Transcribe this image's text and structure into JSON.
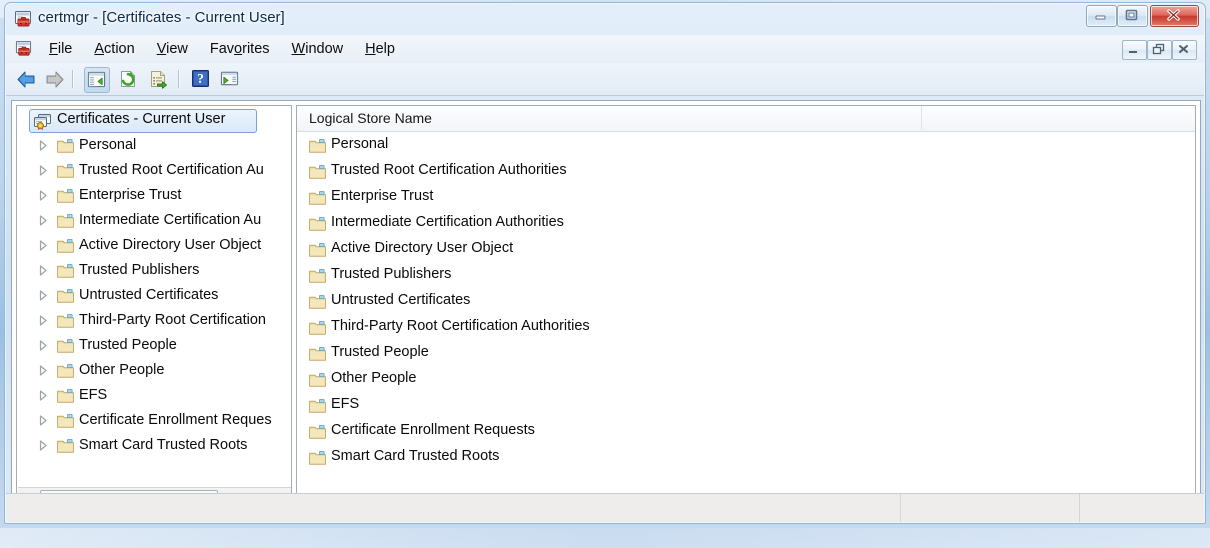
{
  "window": {
    "title": "certmgr - [Certificates - Current User]",
    "app_icon": "mmc-console-icon",
    "controls": {
      "minimize": "Minimize",
      "maximize": "Maximize",
      "close": "Close"
    }
  },
  "menu": {
    "icon": "mmc-console-icon",
    "items": [
      {
        "name": "file",
        "pre": "",
        "accel": "F",
        "post": "ile"
      },
      {
        "name": "action",
        "pre": "",
        "accel": "A",
        "post": "ction"
      },
      {
        "name": "view",
        "pre": "",
        "accel": "V",
        "post": "iew"
      },
      {
        "name": "favorites",
        "pre": "Fav",
        "accel": "o",
        "post": "rites"
      },
      {
        "name": "window",
        "pre": "",
        "accel": "W",
        "post": "indow"
      },
      {
        "name": "help",
        "pre": "",
        "accel": "H",
        "post": "elp"
      }
    ],
    "mdi_controls": {
      "minimize": "Minimize",
      "restore": "Restore",
      "close": "Close"
    }
  },
  "toolbar": {
    "buttons": [
      {
        "name": "back-button",
        "icon": "back-arrow-icon",
        "label": "Back"
      },
      {
        "name": "forward-button",
        "icon": "forward-arrow-icon",
        "label": "Forward"
      },
      {
        "name": "show-tree-button",
        "icon": "show-hide-tree-icon",
        "label": "Show/Hide Console Tree",
        "pressed": true
      },
      {
        "name": "refresh-button",
        "icon": "refresh-icon",
        "label": "Refresh"
      },
      {
        "name": "export-list-button",
        "icon": "export-list-icon",
        "label": "Export List"
      },
      {
        "name": "help-button",
        "icon": "help-icon",
        "label": "Help"
      },
      {
        "name": "show-action-pane-button",
        "icon": "action-pane-icon",
        "label": "Show/Hide Action Pane"
      }
    ]
  },
  "tree": {
    "root": {
      "label": "Certificates - Current User",
      "icon": "certificate-store-icon",
      "selected": true
    },
    "nodes": [
      {
        "label": "Personal",
        "icon": "folder-icon"
      },
      {
        "label": "Trusted Root Certification Au",
        "icon": "folder-icon"
      },
      {
        "label": "Enterprise Trust",
        "icon": "folder-icon"
      },
      {
        "label": "Intermediate Certification Au",
        "icon": "folder-icon"
      },
      {
        "label": "Active Directory User Object",
        "icon": "folder-icon"
      },
      {
        "label": "Trusted Publishers",
        "icon": "folder-icon"
      },
      {
        "label": "Untrusted Certificates",
        "icon": "folder-icon"
      },
      {
        "label": "Third-Party Root Certification",
        "icon": "folder-icon"
      },
      {
        "label": "Trusted People",
        "icon": "folder-icon"
      },
      {
        "label": "Other People",
        "icon": "folder-icon"
      },
      {
        "label": "EFS",
        "icon": "folder-icon"
      },
      {
        "label": "Certificate Enrollment Reques",
        "icon": "folder-icon"
      },
      {
        "label": "Smart Card Trusted Roots",
        "icon": "folder-icon"
      }
    ],
    "scrollbar": {
      "left_arrow": "scroll-left-icon",
      "right_arrow": "scroll-right-icon"
    }
  },
  "list": {
    "columns": [
      {
        "name": "logical-store-name",
        "label": "Logical Store Name"
      },
      {
        "name": "spacer-column",
        "label": ""
      }
    ],
    "rows": [
      {
        "label": "Personal",
        "icon": "folder-icon"
      },
      {
        "label": "Trusted Root Certification Authorities",
        "icon": "folder-icon"
      },
      {
        "label": "Enterprise Trust",
        "icon": "folder-icon"
      },
      {
        "label": "Intermediate Certification Authorities",
        "icon": "folder-icon"
      },
      {
        "label": "Active Directory User Object",
        "icon": "folder-icon"
      },
      {
        "label": "Trusted Publishers",
        "icon": "folder-icon"
      },
      {
        "label": "Untrusted Certificates",
        "icon": "folder-icon"
      },
      {
        "label": "Third-Party Root Certification Authorities",
        "icon": "folder-icon"
      },
      {
        "label": "Trusted People",
        "icon": "folder-icon"
      },
      {
        "label": "Other People",
        "icon": "folder-icon"
      },
      {
        "label": "EFS",
        "icon": "folder-icon"
      },
      {
        "label": "Certificate Enrollment Requests",
        "icon": "folder-icon"
      },
      {
        "label": "Smart Card Trusted Roots",
        "icon": "folder-icon"
      }
    ]
  },
  "statusbar": {
    "panes": [
      "",
      "",
      ""
    ]
  },
  "colors": {
    "title_text": "#0b2a4a",
    "close_button": "#c8392c",
    "folder_body": "#f0dfa8",
    "folder_outline": "#c0a860",
    "folder_tab": "#9ed3e8",
    "selection_fill": "#dceafa",
    "selection_border": "#7da2ce",
    "status_bar": "#efedeb",
    "pane_border": "#a3adb7"
  }
}
